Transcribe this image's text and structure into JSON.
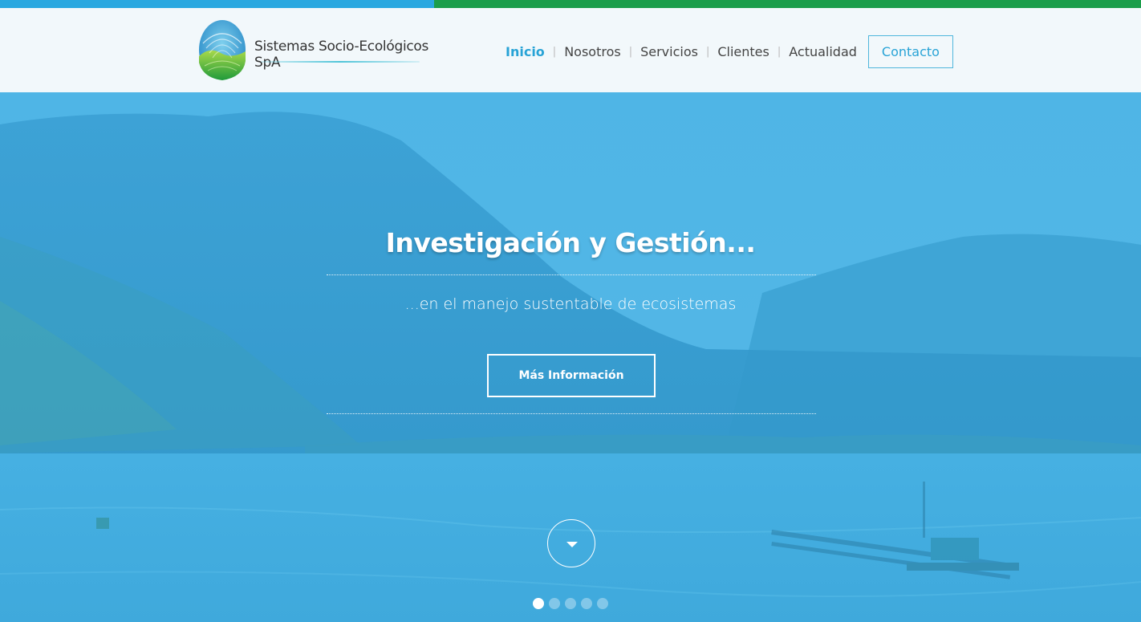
{
  "colors": {
    "top_bar_blue": "#2aa8e0",
    "top_bar_green": "#1b9e4b",
    "header_bg": "#f2f8fb",
    "accent": "#28a3d6",
    "hero_overlay": "#45ace0"
  },
  "brand": {
    "name": "Sistemas Socio-Ecológicos SpA",
    "logo_icon": "fingerprint-globe-icon"
  },
  "nav": {
    "items": [
      {
        "label": "Inicio",
        "active": true
      },
      {
        "label": "Nosotros",
        "active": false
      },
      {
        "label": "Servicios",
        "active": false
      },
      {
        "label": "Clientes",
        "active": false
      },
      {
        "label": "Actualidad",
        "active": false
      }
    ],
    "separator": "|",
    "contact_label": "Contacto"
  },
  "hero": {
    "title": "Investigación y Gestión...",
    "subtitle": "...en el manejo sustentable de ecosistemas",
    "button_label": "Más Información",
    "scroll_icon": "chevron-down-icon",
    "slides": {
      "count": 5,
      "active_index": 0
    }
  }
}
